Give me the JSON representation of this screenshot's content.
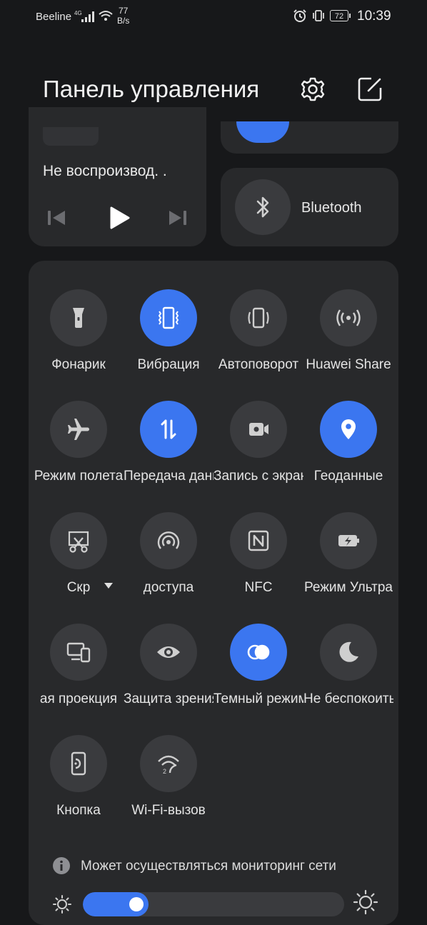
{
  "status_bar": {
    "carrier": "Beeline",
    "net_speed_value": "77",
    "net_speed_unit": "B/s",
    "battery": "72",
    "time": "10:39"
  },
  "header": {
    "title": "Панель управления",
    "settings_icon": "gear-icon",
    "edit_icon": "edit-icon"
  },
  "media": {
    "status": "Не воспроизвод. ."
  },
  "bluetooth": {
    "label": "Bluetooth"
  },
  "tiles": [
    {
      "label": "Фонарик",
      "icon": "flashlight-icon",
      "active": false
    },
    {
      "label": "Вибрация",
      "icon": "vibration-icon",
      "active": true
    },
    {
      "label": "Автоповорот",
      "icon": "auto-rotate-icon",
      "active": false
    },
    {
      "label": "Huawei Share",
      "icon": "share-icon",
      "active": false
    },
    {
      "label": "Режим полета",
      "icon": "airplane-icon",
      "active": false
    },
    {
      "label": "Передача данных",
      "icon": "data-transfer-icon",
      "active": true
    },
    {
      "label": "Запись с экрана",
      "icon": "camera-icon",
      "active": false
    },
    {
      "label": "Геоданные",
      "icon": "location-icon",
      "active": true
    },
    {
      "label": "Скр",
      "icon": "screenshot-icon",
      "active": false
    },
    {
      "label": "доступа",
      "icon": "hotspot-icon",
      "active": false
    },
    {
      "label": "NFC",
      "icon": "nfc-icon",
      "active": false
    },
    {
      "label": "Режим Ультра",
      "icon": "ultra-battery-icon",
      "active": false
    },
    {
      "label": "ая проекция",
      "icon": "projection-icon",
      "active": false
    },
    {
      "label": "Защита зрения",
      "icon": "eye-icon",
      "active": false
    },
    {
      "label": "Темный режим",
      "icon": "dark-mode-icon",
      "active": true
    },
    {
      "label": "Не беспокоить",
      "icon": "moon-icon",
      "active": false
    },
    {
      "label": "Кнопка",
      "icon": "phone-button-icon",
      "active": false
    },
    {
      "label": "Wi-Fi-вызов",
      "icon": "wifi-call-icon",
      "active": false
    }
  ],
  "info": {
    "text": "Может осуществляться мониторинг сети"
  },
  "brightness": {
    "level": 0.25
  },
  "colors": {
    "accent": "#3b76f0",
    "tile_off": "#3a3b3e",
    "card": "#28292b",
    "background": "#17181a"
  }
}
